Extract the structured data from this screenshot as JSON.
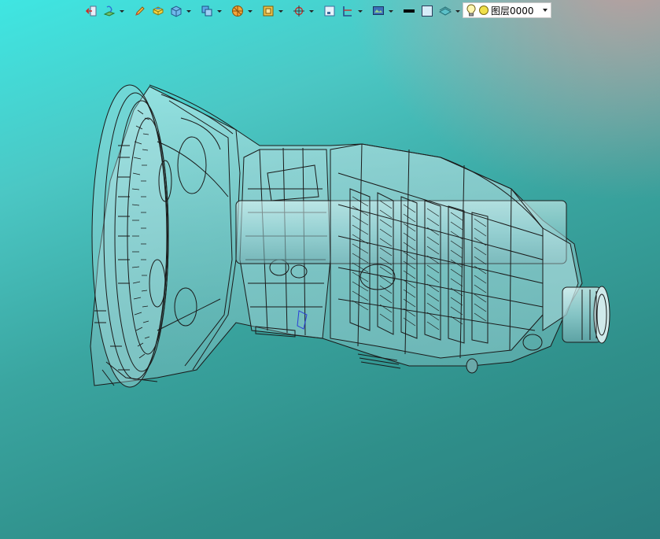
{
  "toolbar": {
    "buttons": [
      {
        "icon": "exit-sketch-icon"
      },
      {
        "icon": "sketch-plane-icon"
      },
      {
        "icon": "pencil-icon"
      },
      {
        "icon": "extrude-icon"
      },
      {
        "icon": "solid-cube-icon"
      },
      {
        "icon": "boolean-icon"
      },
      {
        "icon": "render-mode-icon"
      },
      {
        "icon": "view-orient-icon"
      },
      {
        "icon": "snap-point-icon"
      },
      {
        "icon": "single-view-icon"
      },
      {
        "icon": "section-plane-icon"
      },
      {
        "icon": "display-settings-icon"
      },
      {
        "icon": "line-color-icon"
      },
      {
        "icon": "face-color-icon"
      },
      {
        "icon": "material-icon"
      }
    ]
  },
  "layer": {
    "selected": "图层0000",
    "bulb_icon": "lightbulb-icon",
    "color_icon": "layer-color-icon",
    "color": "#f0e04a"
  },
  "scene": {
    "model": "gearbox-wireframe-model",
    "bg_top": "#3fe6e2",
    "bg_bottom": "#2a7e7f",
    "shell_color": "#a9dcdc",
    "line_color": "#1a1a1a"
  }
}
